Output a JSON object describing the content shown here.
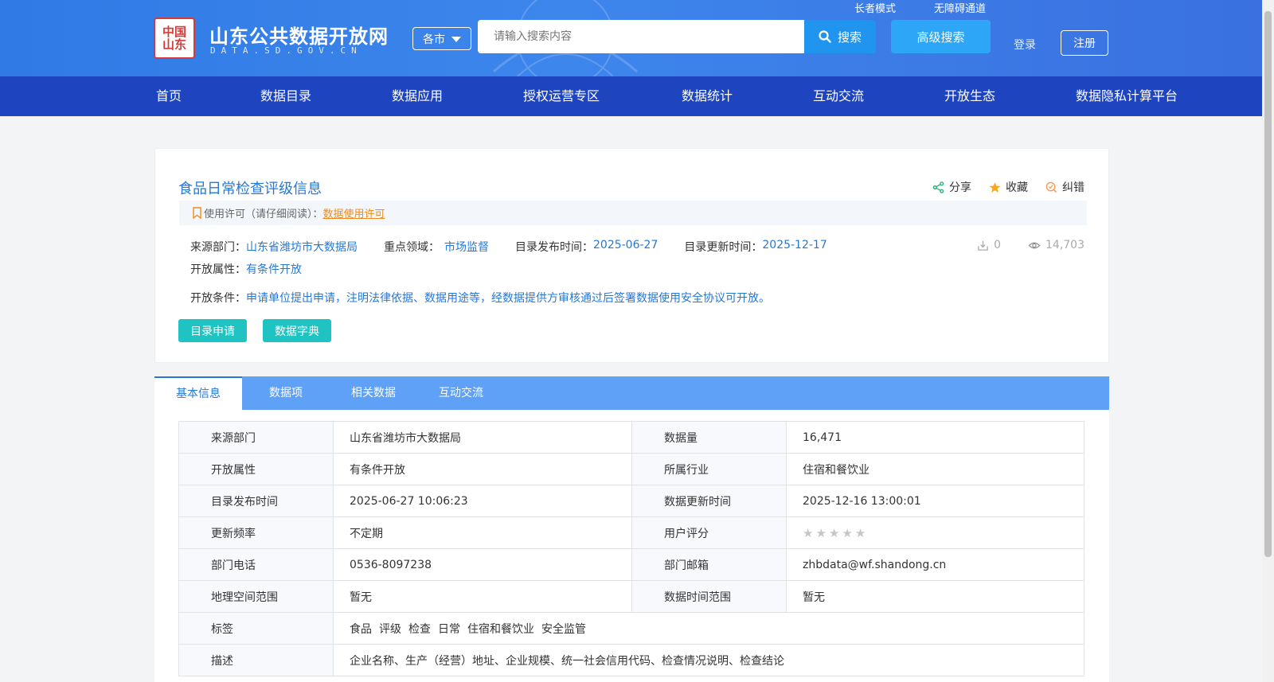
{
  "header": {
    "logo_seal_text": "中国山东",
    "site_title": "山东公共数据开放网",
    "site_subtitle": "DATA.SD.GOV.CN",
    "city_select": "各市",
    "search_placeholder": "请输入搜索内容",
    "search_label": "搜索",
    "advanced_search_label": "高级搜索",
    "elder_mode_label": "长者模式",
    "accessibility_label": "无障碍通道",
    "login_label": "登录",
    "register_label": "注册"
  },
  "nav": {
    "items": [
      "首页",
      "数据目录",
      "数据应用",
      "授权运营专区",
      "数据统计",
      "互动交流",
      "开放生态",
      "数据隐私计算平台"
    ]
  },
  "dataset": {
    "title": "食品日常检查评级信息",
    "actions": {
      "share": "分享",
      "favorite": "收藏",
      "correct": "纠错"
    },
    "license_label": "使用许可（请仔细阅读）：",
    "license_link": "数据使用许可",
    "source_dept_label": "来源部门：",
    "source_dept": "山东省潍坊市大数据局",
    "key_field_label": "重点领域：",
    "key_field": "市场监督",
    "publish_label": "目录发布时间：",
    "publish_date": "2025-06-27",
    "update_label": "目录更新时间：",
    "update_date": "2025-12-17",
    "download_count": "0",
    "view_count": "14,703",
    "open_attr_label": "开放属性：",
    "open_attr": "有条件开放",
    "open_cond_label": "开放条件：",
    "open_cond": "申请单位提出申请，注明法律依据、数据用途等，经数据提供方审核通过后签署数据使用安全协议可开放。",
    "apply_button": "目录申请",
    "dict_button": "数据字典"
  },
  "tabs": [
    "基本信息",
    "数据项",
    "相关数据",
    "互动交流"
  ],
  "info_table": {
    "rows": [
      {
        "l1": "来源部门",
        "v1": "山东省潍坊市大数据局",
        "l2": "数据量",
        "v2": "16,471"
      },
      {
        "l1": "开放属性",
        "v1": "有条件开放",
        "l2": "所属行业",
        "v2": "住宿和餐饮业"
      },
      {
        "l1": "目录发布时间",
        "v1": "2025-06-27 10:06:23",
        "l2": "数据更新时间",
        "v2": "2025-12-16 13:00:01"
      },
      {
        "l1": "更新频率",
        "v1": "不定期",
        "l2": "用户评分",
        "v2": ""
      },
      {
        "l1": "部门电话",
        "v1": "0536-8097238",
        "l2": "部门邮箱",
        "v2": "zhbdata@wf.shandong.cn"
      },
      {
        "l1": "地理空间范围",
        "v1": "暂无",
        "l2": "数据时间范围",
        "v2": "暂无"
      }
    ],
    "rating": 0,
    "tags_label": "标签",
    "tags": [
      "食品",
      "评级",
      "检查",
      "日常",
      "住宿和餐饮业",
      "安全监管"
    ],
    "desc_label": "描述",
    "desc": "企业名称、生产（经营）地址、企业规模、统一社会信用代码、检查情况说明、检查结论"
  },
  "colors": {
    "header_blue": "#3d86ec",
    "nav_blue": "#1e44bf",
    "link_blue": "#2478d6",
    "teal": "#1fc3c1",
    "orange": "#f08c1a"
  }
}
